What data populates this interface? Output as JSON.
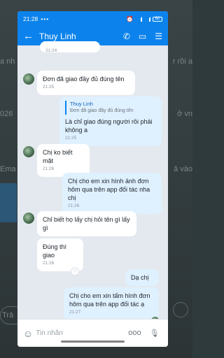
{
  "background": {
    "fragments": [
      "a nh",
      "r rồi a",
      "026",
      "ở vn",
      "Ema",
      "ả vào",
      "Trả"
    ]
  },
  "status_bar": {
    "time": "21:28",
    "dots": "•••",
    "battery": "80"
  },
  "header": {
    "back_icon": "arrow-left",
    "contact_name": "Thuy Linh"
  },
  "messages": [
    {
      "id": "m0",
      "direction": "in",
      "text": "",
      "time": "21:24"
    },
    {
      "id": "m1",
      "direction": "in",
      "text": "Đơn đã giao đầy đủ đúng tên",
      "time": "21:25"
    },
    {
      "id": "m2",
      "direction": "out",
      "quote_name": "Thuy Linh",
      "quote_text": "Đơn đã giao đầy đủ đúng tên",
      "text": "Là chỉ giao đúng người rồi phải không a",
      "time": "21:25"
    },
    {
      "id": "m3",
      "direction": "in",
      "text": "Chị ko biết mặt",
      "time": "21:26"
    },
    {
      "id": "m4",
      "direction": "out",
      "text": "Chị cho em xin hình ảnh đơn hôm qua trên app đối tác nha chị",
      "time": "21:26"
    },
    {
      "id": "m5",
      "direction": "in",
      "text": "Chỉ biết họ lấy chị hỏi tên gì lấy gì",
      "time": ""
    },
    {
      "id": "m6",
      "direction": "in",
      "text": "Đúng thì giao",
      "time": "21:26"
    },
    {
      "id": "m7",
      "direction": "out",
      "text": "Dạ chị",
      "time": ""
    },
    {
      "id": "m8",
      "direction": "out",
      "text": "Chị cho em xin tấm hình đơn hôm qua trên app đối tác ạ",
      "time": "21:27"
    }
  ],
  "input": {
    "placeholder": "Tin nhắn",
    "more_label": "ooo"
  }
}
